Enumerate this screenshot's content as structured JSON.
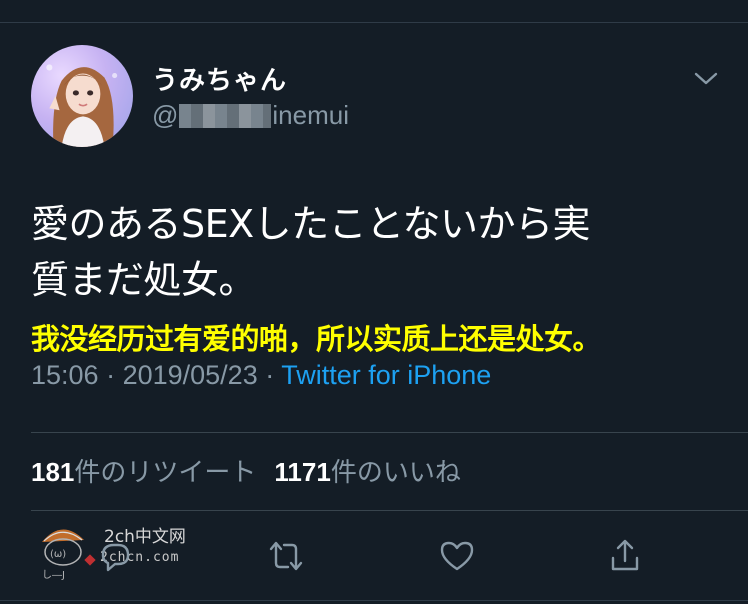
{
  "tweet": {
    "display_name": "うみちゃん",
    "handle_prefix": "@",
    "handle_visible": "inemui",
    "text_line1": "愛のあるSEXしたことないから実",
    "text_line2": "質まだ処女。",
    "translation": "我没经历过有爱的啪，所以实质上还是处女。",
    "time": "15:06",
    "separator": " · ",
    "date": "2019/05/23",
    "source": "Twitter for iPhone"
  },
  "stats": {
    "retweets_count": "181",
    "retweets_label": "件のリツイート",
    "likes_count": "1171",
    "likes_label": "件のいいね"
  },
  "actions": [
    "reply-icon",
    "retweet-icon",
    "like-icon",
    "share-icon"
  ],
  "watermark": {
    "text": "2ch中文网",
    "url": "2chcn.com"
  },
  "colors": {
    "background": "#141d26",
    "secondary_text": "#8899a6",
    "link": "#1da1f2",
    "translation": "#ffff00"
  }
}
